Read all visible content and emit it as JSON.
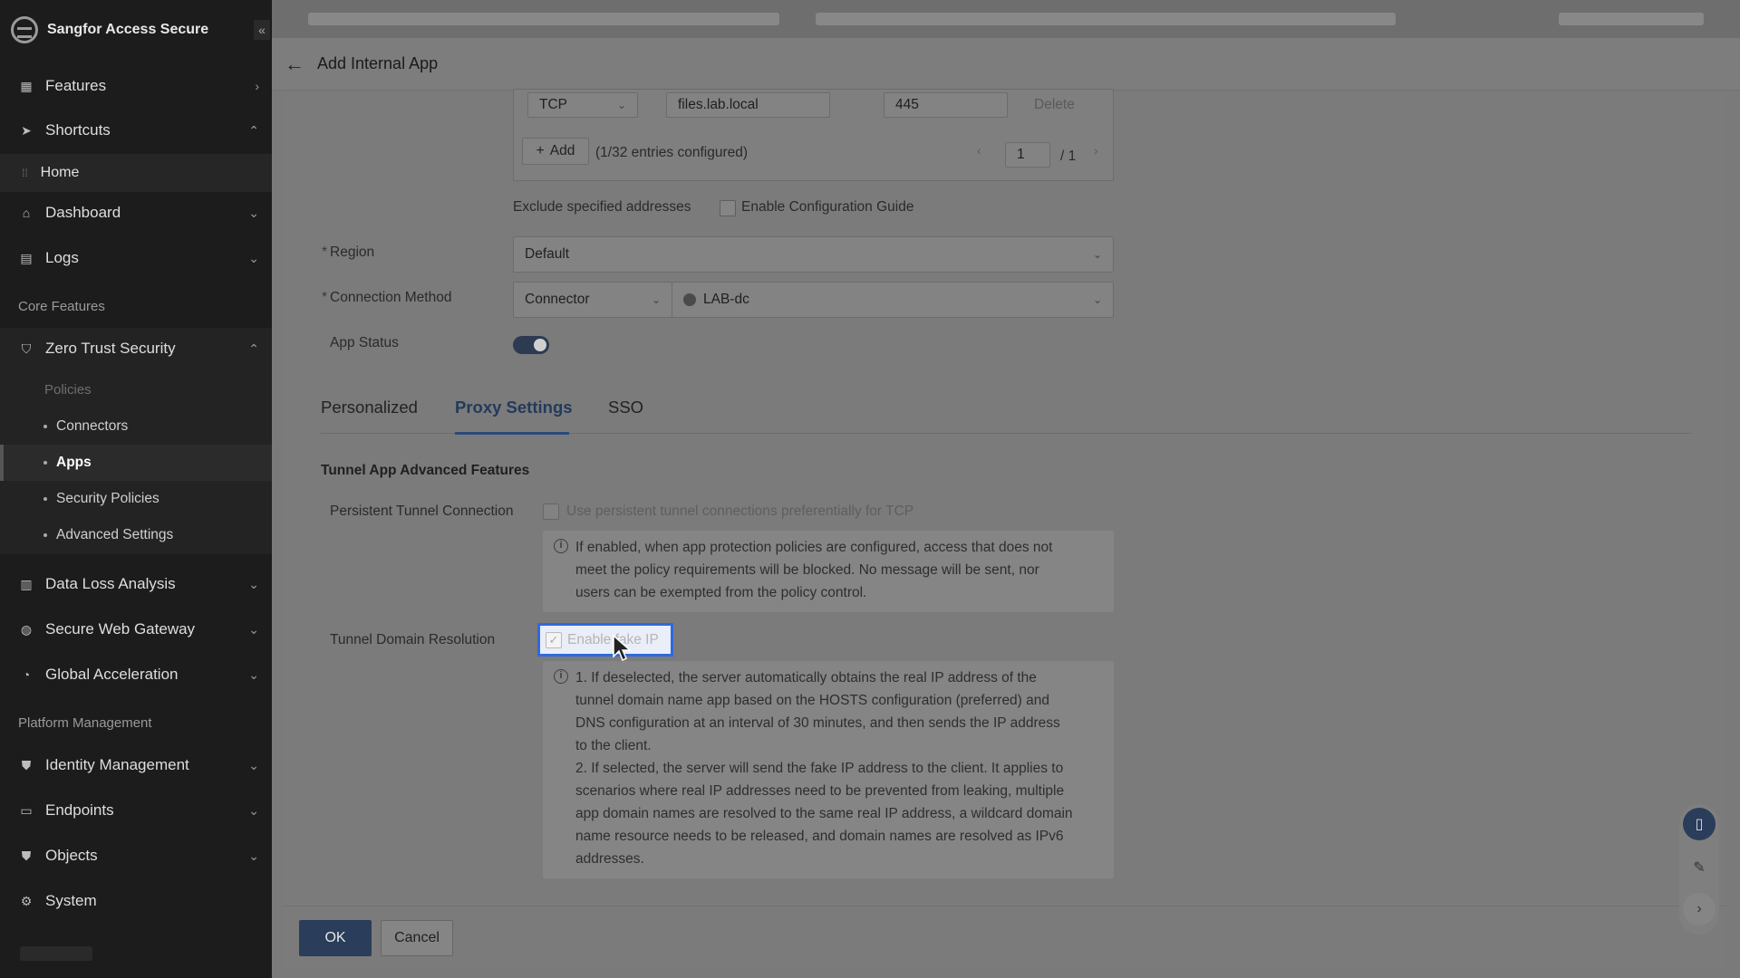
{
  "app": {
    "brand": "Sangfor Access Secure",
    "collapse_glyph": "«"
  },
  "sidebar": {
    "features": "Features",
    "shortcuts": "Shortcuts",
    "home": "Home",
    "dashboard": "Dashboard",
    "logs": "Logs",
    "core_section": "Core Features",
    "zero_trust": "Zero Trust Security",
    "policies_label": "Policies",
    "sub_items": [
      "Connectors",
      "Apps",
      "Security Policies",
      "Advanced Settings"
    ],
    "data_loss": "Data Loss Analysis",
    "swg": "Secure Web Gateway",
    "global_accel": "Global Acceleration",
    "platform_section": "Platform Management",
    "identity": "Identity Management",
    "endpoints": "Endpoints",
    "objects": "Objects",
    "system": "System"
  },
  "header": {
    "title": "Add Internal App"
  },
  "address_row": {
    "protocol": "TCP",
    "address": "files.lab.local",
    "port": "445",
    "delete": "Delete"
  },
  "add_row": {
    "add_label": "Add",
    "entries_text": "(1/32 entries configured)",
    "page_current": "1",
    "page_total": "/ 1"
  },
  "exclude": {
    "label": "Exclude specified addresses",
    "guide_label": "Enable Configuration Guide"
  },
  "region": {
    "label": "Region",
    "value": "Default"
  },
  "connection": {
    "label": "Connection Method",
    "method": "Connector",
    "connector": "LAB-dc"
  },
  "app_status": {
    "label": "App Status",
    "enabled": true
  },
  "tabs": [
    "Personalized",
    "Proxy Settings",
    "SSO"
  ],
  "active_tab": "Proxy Settings",
  "advanced": {
    "title": "Tunnel App Advanced Features",
    "persistent_label": "Persistent Tunnel Connection",
    "persistent_checkbox": "Use persistent tunnel connections preferentially for TCP",
    "persistent_info": [
      "If enabled, when app protection policies are configured, access that does not",
      "meet the policy requirements will be blocked. No message will be sent, nor",
      "users can be exempted from the policy control."
    ],
    "dns_label": "Tunnel Domain Resolution",
    "fake_ip_checkbox": "Enable fake IP",
    "fake_ip_checked": true,
    "dns_info": [
      "1. If deselected, the server automatically obtains the real IP address of the",
      "tunnel domain name app based on the HOSTS configuration (preferred) and",
      "DNS configuration at an interval of 30 minutes, and then sends the IP address",
      "to the client.",
      "2. If selected, the server will send the fake IP address to the client. It applies to",
      "scenarios where real IP addresses need to be prevented from leaking, multiple",
      "app domain names are resolved to the same real IP address, a wildcard domain",
      "name resource needs to be released, and domain names are resolved as IPv6",
      "addresses."
    ]
  },
  "footer": {
    "ok": "OK",
    "cancel": "Cancel"
  },
  "colors": {
    "accent": "#2e6ae0",
    "sidebar_bg": "#1c1c1c",
    "overlay": "#7b7b7b"
  }
}
